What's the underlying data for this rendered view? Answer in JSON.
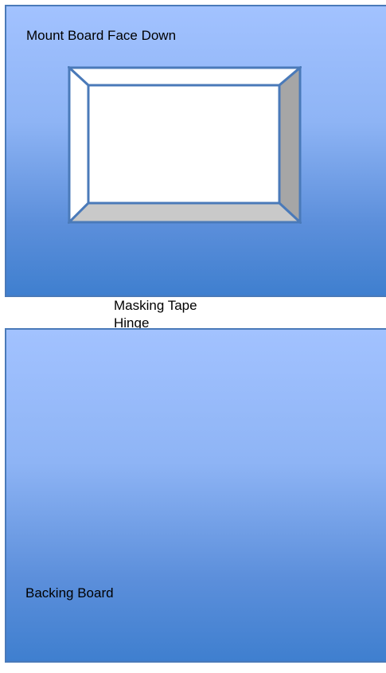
{
  "mount_board": {
    "label": "Mount Board Face Down"
  },
  "hinge": {
    "line1": "Masking Tape",
    "line2": "Hinge"
  },
  "backing_board": {
    "label": "Backing Board"
  },
  "colors": {
    "board_gradient_top": "#a2c2ff",
    "board_gradient_bottom": "#3f7fcf",
    "board_border": "#4a7ab9",
    "bevel_light": "#ffffff",
    "bevel_shadow": "#a6a6a6",
    "hinge": "#ffffff"
  }
}
